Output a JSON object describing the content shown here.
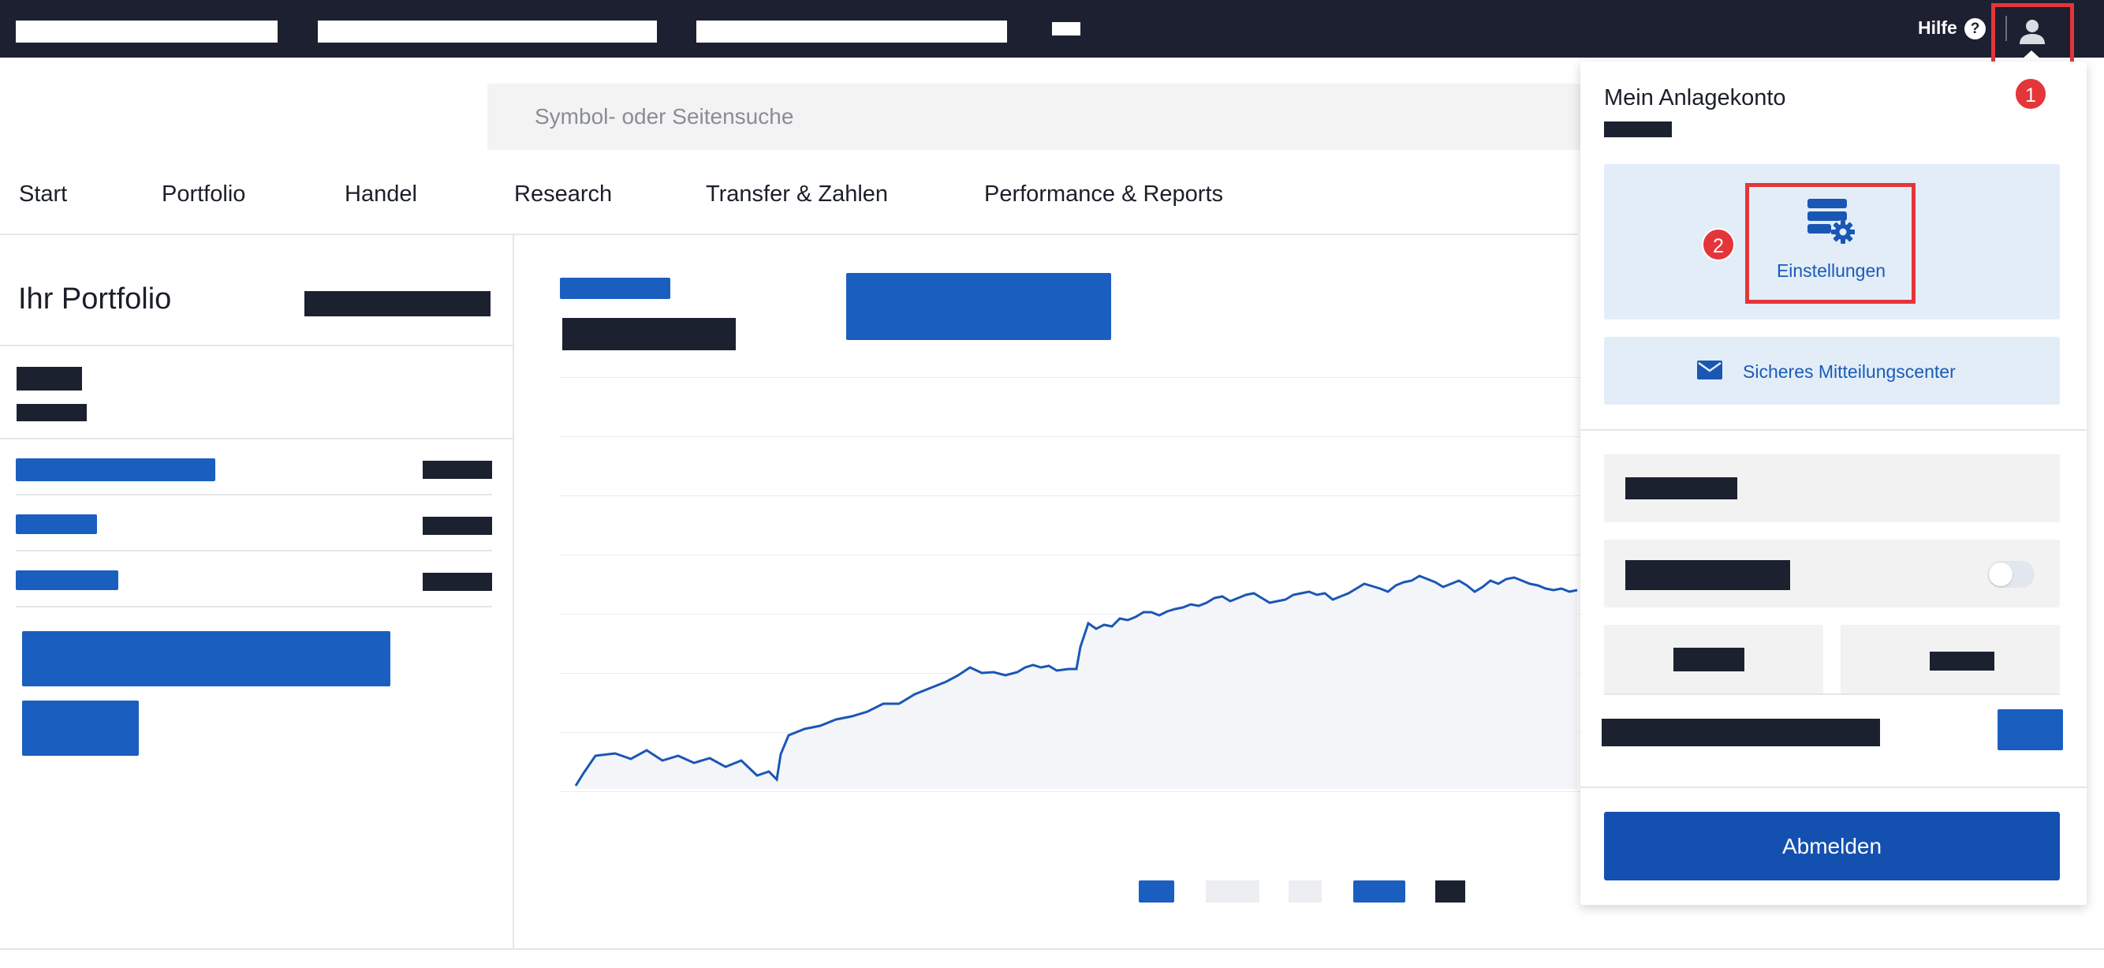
{
  "topbar": {
    "help_label": "Hilfe",
    "help_icon_glyph": "?",
    "user_icon": "user-icon"
  },
  "search": {
    "placeholder": "Symbol- oder Seitensuche"
  },
  "nav": {
    "items": [
      "Start",
      "Portfolio",
      "Handel",
      "Research",
      "Transfer & Zahlen",
      "Performance & Reports"
    ]
  },
  "portfolio": {
    "title": "Ihr Portfolio"
  },
  "account_menu": {
    "title": "Mein Anlagekonto",
    "settings_label": "Einstellungen",
    "settings_icon": "settings-gear-icon",
    "messages_label": "Sicheres Mitteilungscenter",
    "messages_icon": "mail-icon",
    "logout_label": "Abmelden",
    "toggle_on": false
  },
  "annotations": {
    "badge_1": "1",
    "badge_2": "2"
  },
  "colors": {
    "topbar": "#1c2030",
    "accent_blue": "#1a5fbf",
    "logout_blue": "#1450b0",
    "tile_blue": "#e3edf8",
    "highlight_red": "#e4353a"
  }
}
